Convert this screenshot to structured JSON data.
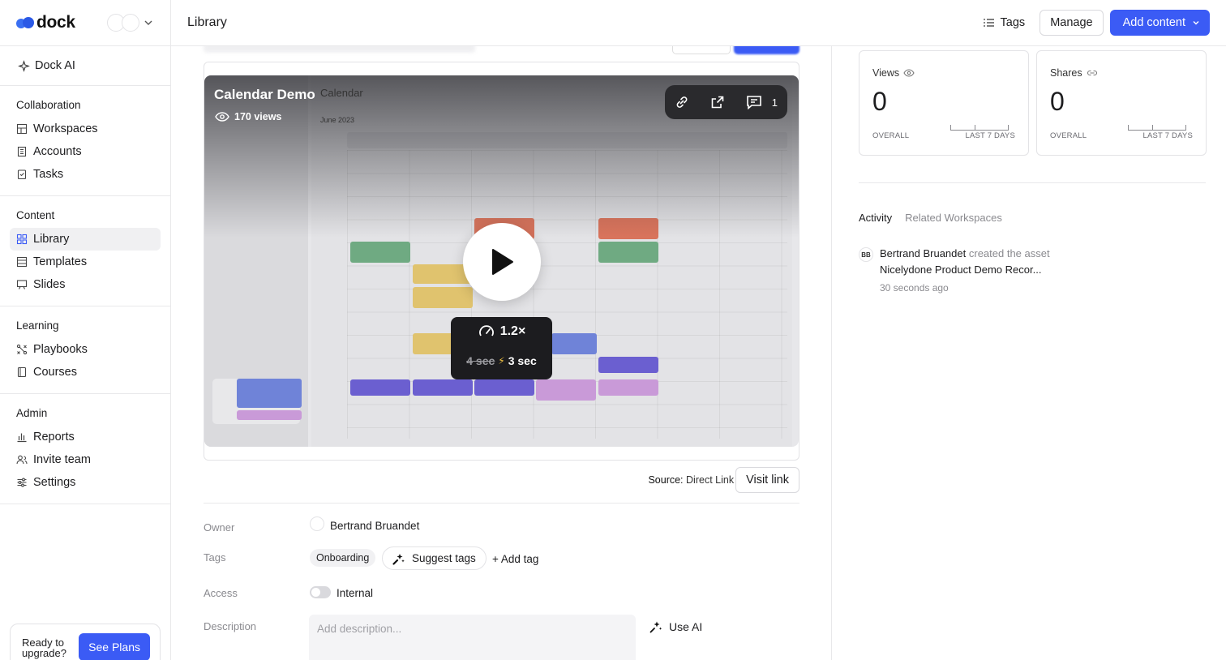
{
  "brand": {
    "name": "dock"
  },
  "sidebar": {
    "dock_ai": "Dock AI",
    "sections": [
      {
        "title": "Collaboration",
        "items": [
          "Workspaces",
          "Accounts",
          "Tasks"
        ]
      },
      {
        "title": "Content",
        "items": [
          "Library",
          "Templates",
          "Slides"
        ]
      },
      {
        "title": "Learning",
        "items": [
          "Playbooks",
          "Courses"
        ]
      },
      {
        "title": "Admin",
        "items": [
          "Reports",
          "Invite team",
          "Settings"
        ]
      }
    ],
    "upgrade": {
      "text": "Ready to upgrade?",
      "button": "See Plans"
    }
  },
  "header": {
    "title": "Library",
    "tags": "Tags",
    "manage": "Manage",
    "add_content": "Add content"
  },
  "video": {
    "title": "Calendar Demo",
    "views": "170 views",
    "comment_count": "1",
    "inner_title": "Calendar",
    "inner_month": "June 2023",
    "speed": "1.2×",
    "old_time": "4 sec",
    "new_time": "3 sec"
  },
  "source": {
    "label": "Source:",
    "value": "Direct Link",
    "visit": "Visit link"
  },
  "fields": {
    "owner_label": "Owner",
    "owner_value": "Bertrand Bruandet",
    "tags_label": "Tags",
    "tag_chip": "Onboarding",
    "suggest_tags": "Suggest tags",
    "add_tag": "+ Add tag",
    "access_label": "Access",
    "access_value": "Internal",
    "description_label": "Description",
    "description_placeholder": "Add description...",
    "use_ai": "Use AI"
  },
  "stats": [
    {
      "label": "Views",
      "value": "0",
      "overall": "OVERALL",
      "period": "LAST 7 DAYS"
    },
    {
      "label": "Shares",
      "value": "0",
      "overall": "OVERALL",
      "period": "LAST 7 DAYS"
    }
  ],
  "tabs": {
    "activity": "Activity",
    "related": "Related Workspaces"
  },
  "activity": {
    "initials": "BB",
    "actor": "Bertrand Bruandet",
    "verb": "created the asset",
    "asset": "Nicelydone Product Demo Recor...",
    "time": "30 seconds ago"
  },
  "colors": {
    "accent": "#3b5bf5",
    "logo": "#2b59e6"
  }
}
